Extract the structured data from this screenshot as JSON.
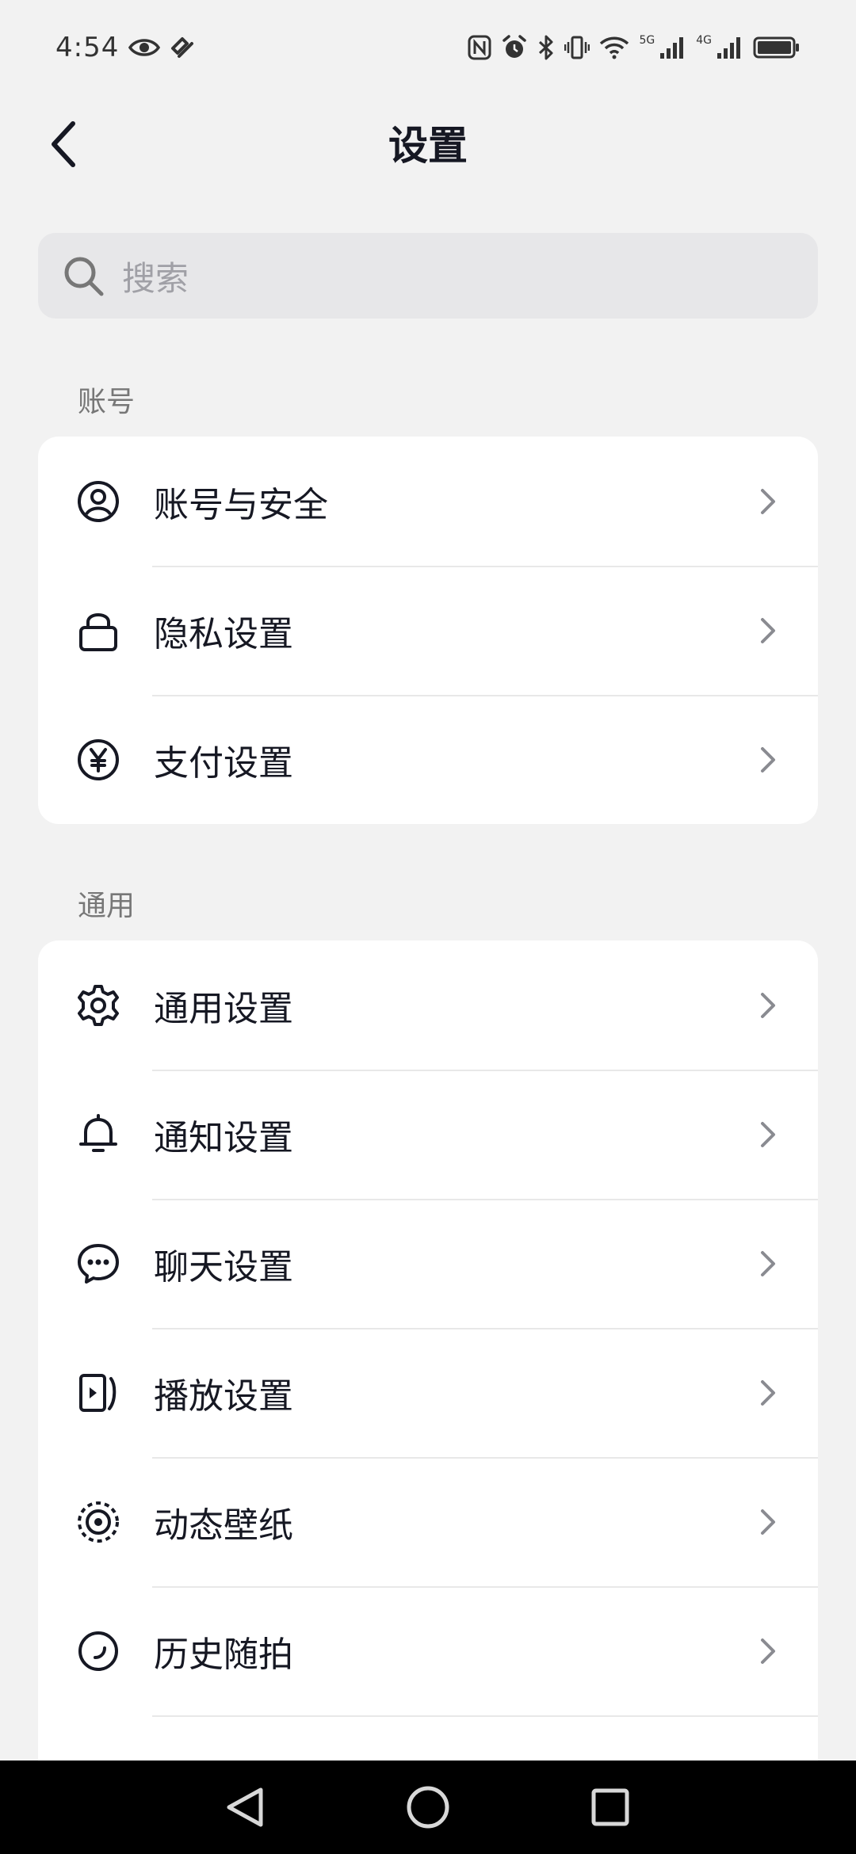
{
  "status_bar": {
    "time": "4:54",
    "net_5g": "5G",
    "net_4g": "4G"
  },
  "header": {
    "title": "设置",
    "back_icon": "chevron-left-icon"
  },
  "search": {
    "placeholder": "搜索",
    "icon": "search-icon"
  },
  "sections": [
    {
      "label": "账号",
      "items": [
        {
          "label": "账号与安全",
          "icon": "user-circle-icon"
        },
        {
          "label": "隐私设置",
          "icon": "lock-icon"
        },
        {
          "label": "支付设置",
          "icon": "yen-icon"
        }
      ]
    },
    {
      "label": "通用",
      "items": [
        {
          "label": "通用设置",
          "icon": "gear-icon"
        },
        {
          "label": "通知设置",
          "icon": "bell-icon"
        },
        {
          "label": "聊天设置",
          "icon": "chat-bubble-icon"
        },
        {
          "label": "播放设置",
          "icon": "play-screen-icon"
        },
        {
          "label": "动态壁纸",
          "icon": "live-wallpaper-icon"
        },
        {
          "label": "历史随拍",
          "icon": "history-icon"
        }
      ]
    }
  ]
}
